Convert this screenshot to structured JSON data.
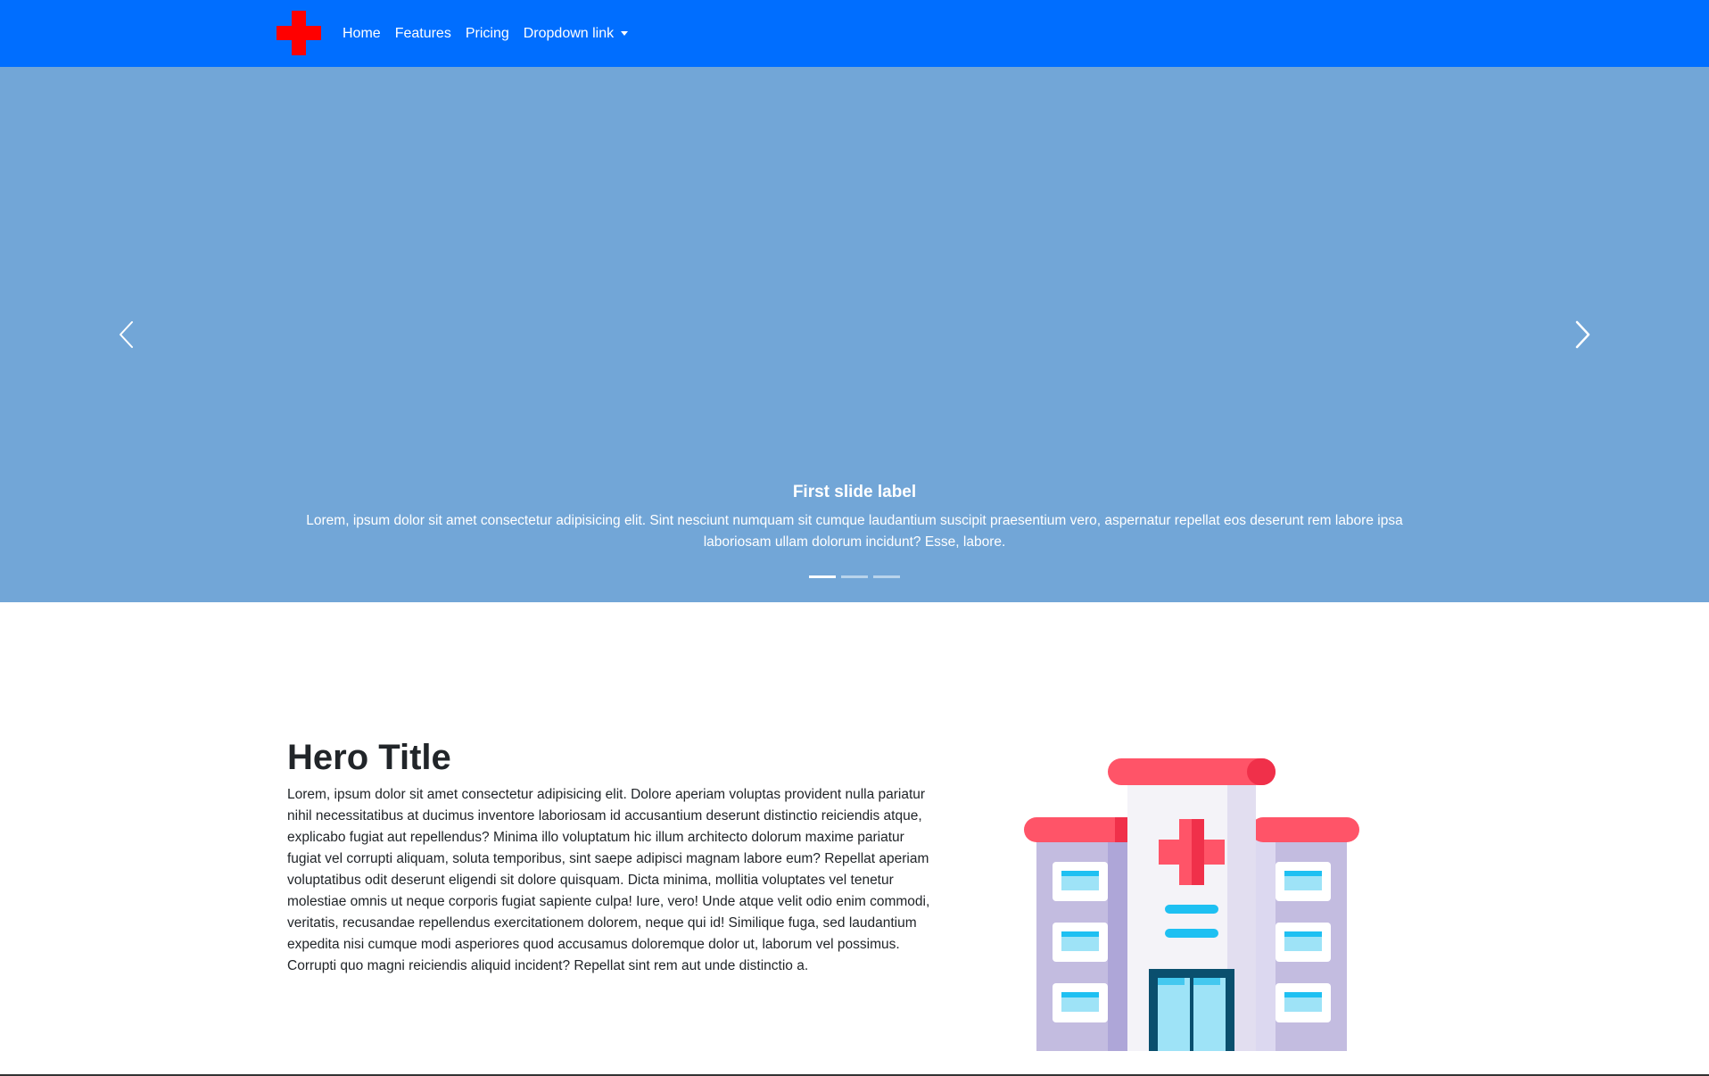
{
  "colors": {
    "navbar_bg": "#006eff",
    "carousel_bg": "#72a6d7",
    "brand_cross": "#ff0000",
    "roof_red": "#ff5468",
    "wall_purple": "#c3bce0",
    "window_blue": "#6fd3f4"
  },
  "navbar": {
    "brand_icon": "red-cross-icon",
    "links": [
      {
        "label": "Home"
      },
      {
        "label": "Features"
      },
      {
        "label": "Pricing"
      },
      {
        "label": "Dropdown link",
        "icon": "caret-down-icon"
      }
    ]
  },
  "carousel": {
    "prev_icon": "chevron-left-icon",
    "next_icon": "chevron-right-icon",
    "caption_title": "First slide label",
    "caption_text": "Lorem, ipsum dolor sit amet consectetur adipisicing elit. Sint nesciunt numquam sit cumque laudantium suscipit praesentium vero, aspernatur repellat eos deserunt rem labore ipsa laboriosam ullam dolorum incidunt? Esse, labore.",
    "slide_count": 3,
    "active_index": 0
  },
  "hero": {
    "title": "Hero Title",
    "body": "Lorem, ipsum dolor sit amet consectetur adipisicing elit. Dolore aperiam voluptas provident nulla pariatur nihil necessitatibus at ducimus inventore laboriosam id accusantium deserunt distinctio reiciendis atque, explicabo fugiat aut repellendus? Minima illo voluptatum hic illum architecto dolorum maxime pariatur fugiat vel corrupti aliquam, soluta temporibus, sint saepe adipisci magnam labore eum? Repellat aperiam voluptatibus odit deserunt eligendi sit dolore quisquam. Dicta minima, mollitia voluptates vel tenetur molestiae omnis ut neque corporis fugiat sapiente culpa! Iure, vero! Unde atque velit odio enim commodi, veritatis, recusandae repellendus exercitationem dolorem, neque qui id! Similique fuga, sed laudantium expedita nisi cumque modi asperiores quod accusamus doloremque dolor ut, laborum vel possimus. Corrupti quo magni reiciendis aliquid incident? Repellat sint rem aut unde distinctio a.",
    "illustration_icon": "hospital-building-icon"
  }
}
